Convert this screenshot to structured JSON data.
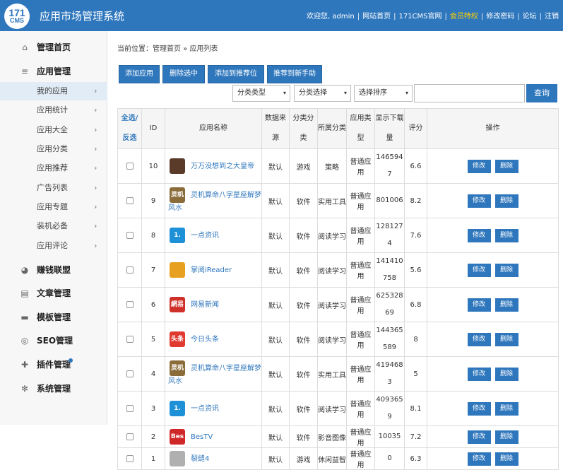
{
  "header": {
    "logo_top": "171",
    "logo_bottom": "CMS",
    "title": "应用市场管理系统",
    "nav": [
      "欢迎您, admin",
      "网站首页",
      "171CMS官网",
      "会员特权",
      "修改密码",
      "论坛",
      "注销"
    ],
    "separator": "|"
  },
  "sidebar": {
    "items": [
      {
        "label": "管理首页",
        "icon": "home-icon",
        "type": "main"
      },
      {
        "label": "应用管理",
        "icon": "menu-icon",
        "type": "main"
      },
      {
        "label": "我的应用",
        "type": "sub",
        "arrow": "›"
      },
      {
        "label": "应用统计",
        "type": "sub",
        "arrow": "›"
      },
      {
        "label": "应用大全",
        "type": "sub",
        "arrow": "›"
      },
      {
        "label": "应用分类",
        "type": "sub",
        "arrow": "›"
      },
      {
        "label": "应用推荐",
        "type": "sub",
        "arrow": "›"
      },
      {
        "label": "广告列表",
        "type": "sub",
        "arrow": "›"
      },
      {
        "label": "应用专题",
        "type": "sub",
        "arrow": "›"
      },
      {
        "label": "装机必备",
        "type": "sub",
        "arrow": "›"
      },
      {
        "label": "应用评论",
        "type": "sub",
        "arrow": "›"
      },
      {
        "label": "赚钱联盟",
        "icon": "pie-chart-icon",
        "type": "main"
      },
      {
        "label": "文章管理",
        "icon": "document-icon",
        "type": "main"
      },
      {
        "label": "模板管理",
        "icon": "folder-icon",
        "type": "main"
      },
      {
        "label": "SEO管理",
        "icon": "seo-icon",
        "type": "main"
      },
      {
        "label": "插件管理",
        "icon": "puzzle-icon",
        "type": "main"
      },
      {
        "label": "系统管理",
        "icon": "gear-icon",
        "type": "main"
      }
    ]
  },
  "breadcrumb": "当前位置：管理首页 » 应用列表",
  "toolbar": {
    "add": "添加应用",
    "delete_selected": "删除选中",
    "add_recommend": "添加到推荐位",
    "recommend_new": "推荐到新手助"
  },
  "filters": {
    "category_type": "分类类型",
    "category_select": "分类选择",
    "sort_select": "选择排序",
    "caret": "▾",
    "search_button": "查询"
  },
  "table": {
    "headers": {
      "select_all": "全选/反选",
      "id": "ID",
      "name": "应用名称",
      "source": "数据来源",
      "category": "分类分类",
      "belong": "所属分类",
      "app_type": "应用类型",
      "downloads": "显示下载量",
      "rating": "评分",
      "actions": "操作"
    },
    "edit_label": "修改",
    "delete_label": "删除",
    "rows": [
      {
        "id": "10",
        "name": "万万没想到之大皇帝",
        "icon_color": "#5a3b2a",
        "icon_text": "",
        "source": "默认",
        "category": "游戏",
        "belong": "策略",
        "app_type": "普通应用",
        "downloads": "1465947",
        "rating": "6.6"
      },
      {
        "id": "9",
        "name": "灵机算命八字星座解梦风水",
        "icon_color": "#8a6b3a",
        "icon_text": "灵机",
        "source": "默认",
        "category": "软件",
        "belong": "实用工具",
        "app_type": "普通应用",
        "downloads": "801006",
        "rating": "8.2"
      },
      {
        "id": "8",
        "name": "一点资讯",
        "icon_color": "#1e90d8",
        "icon_text": "1.",
        "source": "默认",
        "category": "软件",
        "belong": "阅读学习",
        "app_type": "普通应用",
        "downloads": "1281274",
        "rating": "7.6"
      },
      {
        "id": "7",
        "name": "掌阅iReader",
        "icon_color": "#e8a020",
        "icon_text": "",
        "source": "默认",
        "category": "软件",
        "belong": "阅读学习",
        "app_type": "普通应用",
        "downloads": "141410758",
        "rating": "5.6"
      },
      {
        "id": "6",
        "name": "网易新闻",
        "icon_color": "#d0302a",
        "icon_text": "網易",
        "source": "默认",
        "category": "软件",
        "belong": "阅读学习",
        "app_type": "普通应用",
        "downloads": "62532869",
        "rating": "6.8"
      },
      {
        "id": "5",
        "name": "今日头条",
        "icon_color": "#e03a30",
        "icon_text": "头条",
        "source": "默认",
        "category": "软件",
        "belong": "阅读学习",
        "app_type": "普通应用",
        "downloads": "144365589",
        "rating": "8"
      },
      {
        "id": "4",
        "name": "灵机算命八字星座解梦风水",
        "icon_color": "#8a6b3a",
        "icon_text": "灵机",
        "source": "默认",
        "category": "软件",
        "belong": "实用工具",
        "app_type": "普通应用",
        "downloads": "4194683",
        "rating": "5"
      },
      {
        "id": "3",
        "name": "一点资讯",
        "icon_color": "#1e90d8",
        "icon_text": "1.",
        "source": "默认",
        "category": "软件",
        "belong": "阅读学习",
        "app_type": "普通应用",
        "downloads": "4093659",
        "rating": "8.1"
      },
      {
        "id": "2",
        "name": "BesTV",
        "icon_color": "#d02828",
        "icon_text": "BesTV",
        "source": "默认",
        "category": "软件",
        "belong": "影音图像",
        "app_type": "普通应用",
        "downloads": "10035",
        "rating": "7.2"
      },
      {
        "id": "1",
        "name": "裂缝4",
        "icon_color": "#b0b0b0",
        "icon_text": "",
        "source": "默认",
        "category": "游戏",
        "belong": "休闲益智",
        "app_type": "普通应用",
        "downloads": "0",
        "rating": "6.3"
      }
    ]
  }
}
